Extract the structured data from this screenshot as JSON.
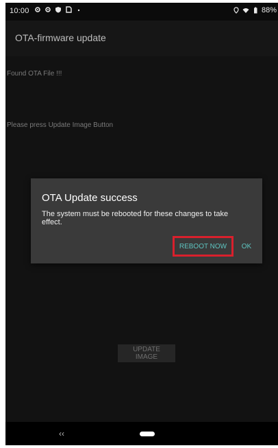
{
  "status_bar": {
    "time": "10:00",
    "battery": "88%"
  },
  "app_bar": {
    "title": "OTA-firmware update"
  },
  "content": {
    "found_text": "Found OTA File !!!",
    "instruction_text": "Please press Update Image Button"
  },
  "dialog": {
    "title": "OTA Update success",
    "message": "The system must be rebooted for these changes to take effect.",
    "reboot_label": "REBOOT NOW",
    "ok_label": "OK",
    "highlight_color": "#d9202c",
    "accent_color": "#5ec4c0"
  },
  "update_button": {
    "label": "UPDATE IMAGE"
  },
  "nav_bar": {
    "back_label": "‹‹"
  }
}
